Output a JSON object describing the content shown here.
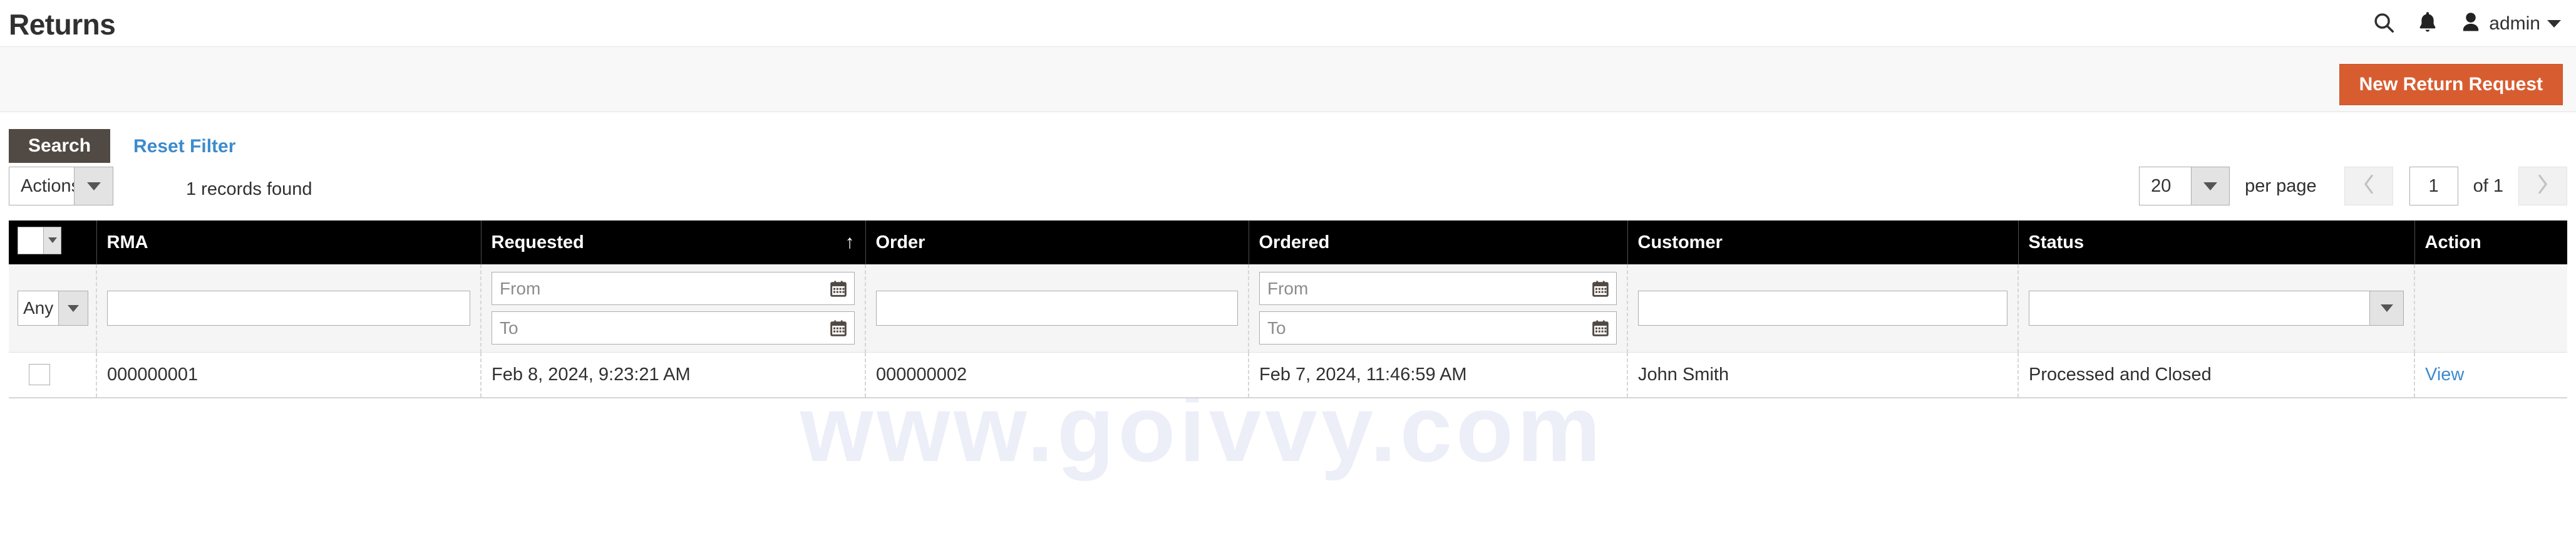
{
  "header": {
    "title": "Returns",
    "search_icon": "search-icon",
    "notification_icon": "bell-icon",
    "avatar_icon": "user-avatar-icon",
    "admin_user": "admin"
  },
  "sub_header": {
    "new_return_request_label": "New Return Request",
    "button_color": "#d75d31"
  },
  "filter_actions": {
    "search_label": "Search",
    "reset_filter_label": "Reset Filter",
    "search_button_color": "#514943",
    "link_color": "#3d8bcd"
  },
  "toolbar": {
    "actions_label": "Actions",
    "records_found": "1 records found",
    "per_page_value": "20",
    "per_page_label": "per page",
    "prev_page_icon": "chevron-left-icon",
    "next_page_icon": "chevron-right-icon",
    "page_value": "1",
    "page_of": "of 1"
  },
  "grid": {
    "columns": [
      {
        "key": "checkbox",
        "label": "",
        "sort": ""
      },
      {
        "key": "rma",
        "label": "RMA",
        "sort": ""
      },
      {
        "key": "requested",
        "label": "Requested",
        "sort": "asc"
      },
      {
        "key": "order",
        "label": "Order",
        "sort": ""
      },
      {
        "key": "ordered",
        "label": "Ordered",
        "sort": ""
      },
      {
        "key": "customer",
        "label": "Customer",
        "sort": ""
      },
      {
        "key": "status",
        "label": "Status",
        "sort": ""
      },
      {
        "key": "action",
        "label": "Action",
        "sort": ""
      }
    ],
    "sort_asc_glyph": "↑",
    "filters": {
      "any_value": "Any",
      "rma_value": "",
      "requested_from_placeholder": "From",
      "requested_from_value": "",
      "requested_to_placeholder": "To",
      "requested_to_value": "",
      "order_value": "",
      "ordered_from_placeholder": "From",
      "ordered_from_value": "",
      "ordered_to_placeholder": "To",
      "ordered_to_value": "",
      "customer_value": "",
      "status_value": "",
      "calendar_icon": "calendar-icon"
    },
    "rows": [
      {
        "rma": "000000001",
        "requested": "Feb 8, 2024, 9:23:21 AM",
        "order": "000000002",
        "ordered": "Feb 7, 2024, 11:46:59 AM",
        "customer": "John Smith",
        "status": "Processed and Closed",
        "action": "View"
      }
    ]
  },
  "watermark": {
    "text": "www.goivvy.com"
  }
}
